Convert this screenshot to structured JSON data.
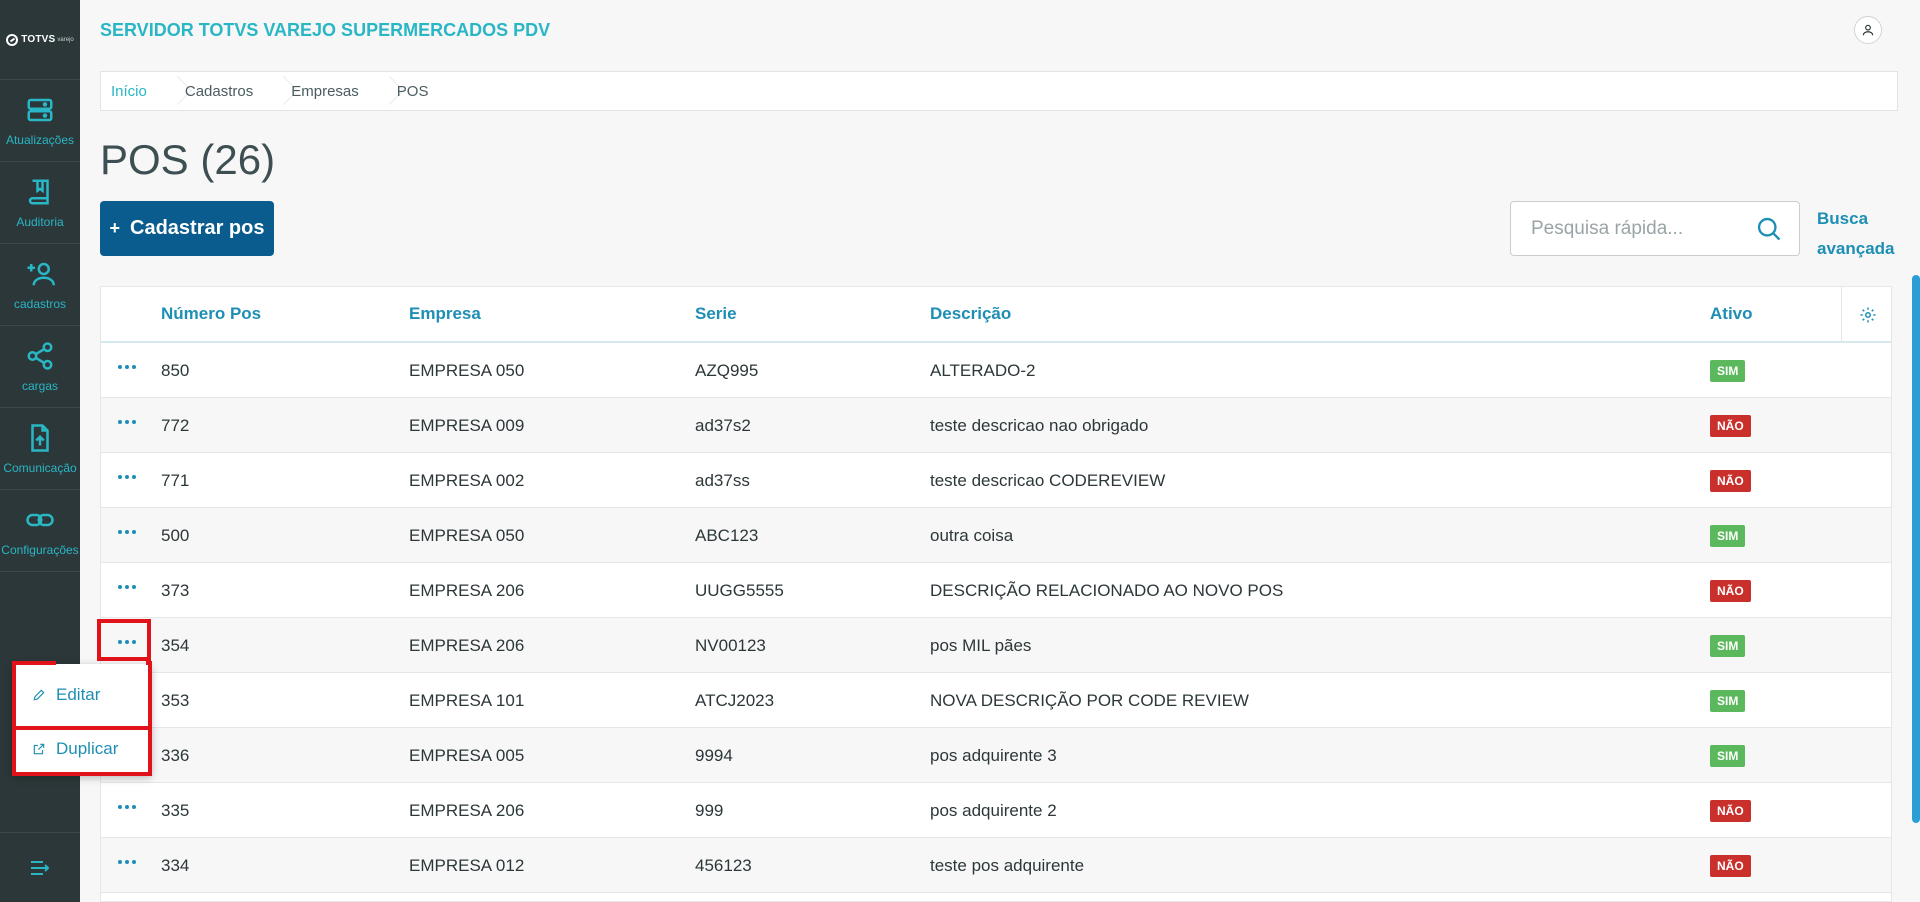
{
  "app": {
    "title": "SERVIDOR TOTVS VAREJO SUPERMERCADOS PDV",
    "logo_text": "TOTVS",
    "logo_sub": "varejo"
  },
  "sidebar": {
    "items": [
      {
        "label": "Atualizações",
        "icon": "server-icon"
      },
      {
        "label": "Auditoria",
        "icon": "book-icon"
      },
      {
        "label": "cadastros",
        "icon": "add-user-icon"
      },
      {
        "label": "cargas",
        "icon": "share-icon"
      },
      {
        "label": "Comunicação",
        "icon": "file-upload-icon"
      },
      {
        "label": "Configurações",
        "icon": "link-icon"
      }
    ]
  },
  "breadcrumb": [
    "Início",
    "Cadastros",
    "Empresas",
    "POS"
  ],
  "page": {
    "title": "POS (26)"
  },
  "toolbar": {
    "add_label": "Cadastrar pos",
    "search_placeholder": "Pesquisa rápida...",
    "advanced_search_line1": "Busca",
    "advanced_search_line2": "avançada"
  },
  "table": {
    "columns": [
      "Número Pos",
      "Empresa",
      "Serie",
      "Descrição",
      "Ativo"
    ],
    "rows": [
      {
        "numero": "850",
        "empresa": "EMPRESA 050",
        "serie": "AZQ995",
        "descricao": "ALTERADO-2",
        "ativo": "SIM"
      },
      {
        "numero": "772",
        "empresa": "EMPRESA 009",
        "serie": "ad37s2",
        "descricao": "teste descricao nao obrigado",
        "ativo": "NÃO"
      },
      {
        "numero": "771",
        "empresa": "EMPRESA 002",
        "serie": "ad37ss",
        "descricao": "teste descricao CODEREVIEW",
        "ativo": "NÃO"
      },
      {
        "numero": "500",
        "empresa": "EMPRESA 050",
        "serie": "ABC123",
        "descricao": "outra coisa",
        "ativo": "SIM"
      },
      {
        "numero": "373",
        "empresa": "EMPRESA 206",
        "serie": "UUGG5555",
        "descricao": "DESCRIÇÃO RELACIONADO AO NOVO POS",
        "ativo": "NÃO"
      },
      {
        "numero": "354",
        "empresa": "EMPRESA 206",
        "serie": "NV00123",
        "descricao": "pos MIL pães",
        "ativo": "SIM"
      },
      {
        "numero": "353",
        "empresa": "EMPRESA 101",
        "serie": "ATCJ2023",
        "descricao": "NOVA DESCRIÇÃO POR CODE REVIEW",
        "ativo": "SIM"
      },
      {
        "numero": "336",
        "empresa": "EMPRESA 005",
        "serie": "9994",
        "descricao": "pos adquirente 3",
        "ativo": "SIM"
      },
      {
        "numero": "335",
        "empresa": "EMPRESA 206",
        "serie": "999",
        "descricao": "pos adquirente 2",
        "ativo": "NÃO"
      },
      {
        "numero": "334",
        "empresa": "EMPRESA 012",
        "serie": "456123",
        "descricao": "teste pos adquirente",
        "ativo": "NÃO"
      }
    ]
  },
  "context_menu": {
    "edit_label": "Editar",
    "duplicate_label": "Duplicar"
  },
  "colors": {
    "sidebar": "#2c3739",
    "accent": "#29b6c5",
    "primary": "#0a5c8e",
    "link": "#1e8fb4",
    "yes": "#5cb85c",
    "no": "#c9302c",
    "highlight": "#e2121a"
  }
}
